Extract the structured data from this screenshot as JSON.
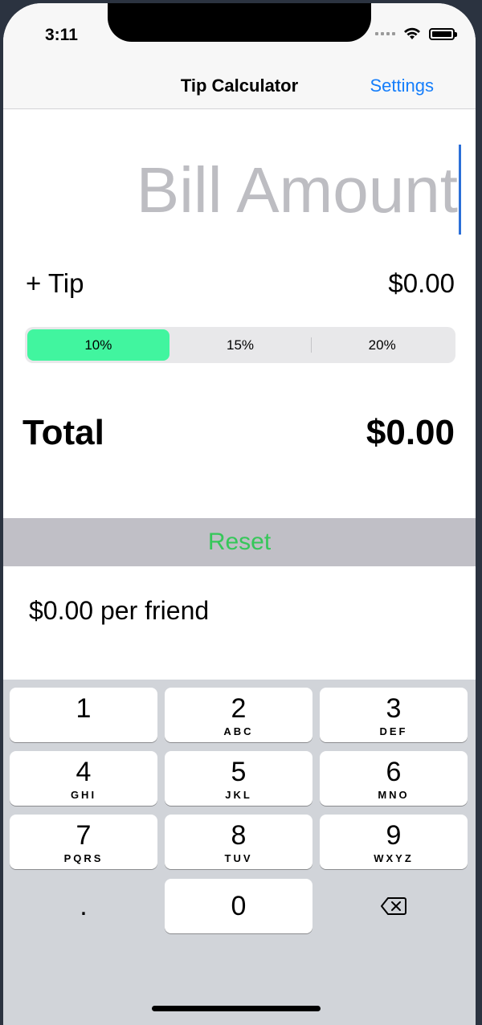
{
  "status_bar": {
    "time": "3:11"
  },
  "nav": {
    "title": "Tip Calculator",
    "settings_label": "Settings"
  },
  "bill": {
    "placeholder": "Bill Amount",
    "value": ""
  },
  "tip": {
    "label": "+ Tip",
    "amount": "$0.00"
  },
  "tip_options": {
    "selected": "10%",
    "options": [
      "10%",
      "15%",
      "20%"
    ]
  },
  "total": {
    "label": "Total",
    "amount": "$0.00"
  },
  "reset_label": "Reset",
  "per_friend": "$0.00 per friend",
  "keypad": {
    "keys": [
      {
        "digit": "1",
        "letters": ""
      },
      {
        "digit": "2",
        "letters": "ABC"
      },
      {
        "digit": "3",
        "letters": "DEF"
      },
      {
        "digit": "4",
        "letters": "GHI"
      },
      {
        "digit": "5",
        "letters": "JKL"
      },
      {
        "digit": "6",
        "letters": "MNO"
      },
      {
        "digit": "7",
        "letters": "PQRS"
      },
      {
        "digit": "8",
        "letters": "TUV"
      },
      {
        "digit": "9",
        "letters": "WXYZ"
      },
      {
        "digit": ".",
        "letters": ""
      },
      {
        "digit": "0",
        "letters": ""
      },
      {
        "digit": "",
        "letters": "",
        "icon": "backspace-icon"
      }
    ]
  },
  "colors": {
    "accent_blue": "#157efb",
    "selected_segment": "#41f59f",
    "reset_green": "#35c759",
    "placeholder_gray": "#bdbdc2"
  }
}
